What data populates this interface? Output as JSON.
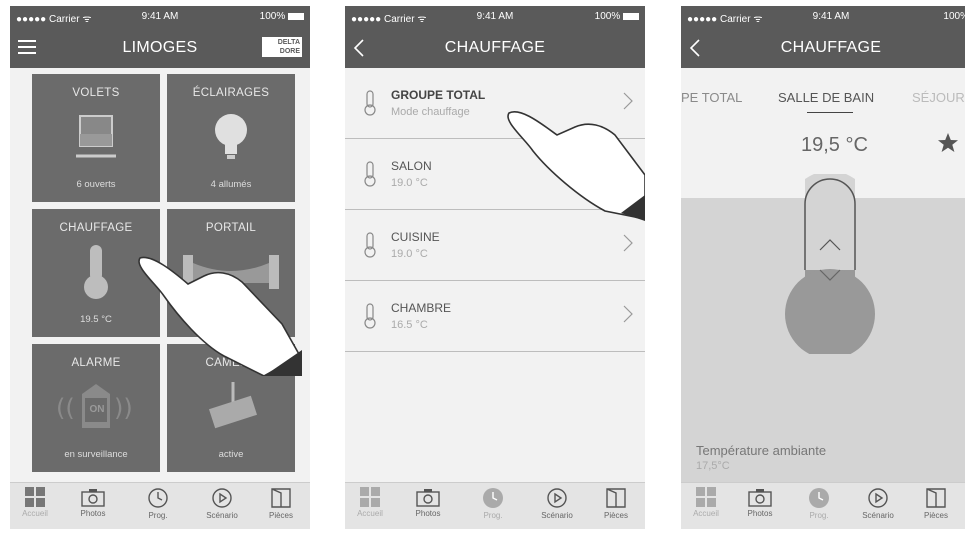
{
  "status": {
    "carrier": "●●●●● Carrier ᯤ",
    "time": "9:41 AM",
    "battery": "100%"
  },
  "home": {
    "title": "LIMOGES",
    "brand": "DELTA DORE",
    "tiles": [
      {
        "title": "VOLETS",
        "sub": "6 ouverts",
        "icon": "shutter-icon"
      },
      {
        "title": "ÉCLAIRAGES",
        "sub": "4 allumés",
        "icon": "bulb-icon"
      },
      {
        "title": "CHAUFFAGE",
        "sub": "19.5 °C",
        "icon": "thermometer-icon"
      },
      {
        "title": "PORTAIL",
        "sub": "",
        "icon": "gate-icon"
      },
      {
        "title": "ALARME",
        "sub": "en surveillance",
        "icon": "alarm-icon",
        "badge": "ON"
      },
      {
        "title": "CAMÉRA",
        "sub": "active",
        "icon": "camera-icon"
      }
    ]
  },
  "heating": {
    "title": "CHAUFFAGE",
    "rows": [
      {
        "name": "GROUPE TOTAL",
        "value": "Mode chauffage"
      },
      {
        "name": "SALON",
        "value": "19.0 °C"
      },
      {
        "name": "CUISINE",
        "value": "19.0 °C"
      },
      {
        "name": "CHAMBRE",
        "value": "16.5 °C"
      }
    ]
  },
  "room": {
    "title": "CHAUFFAGE",
    "tabs": [
      "PE TOTAL",
      "SALLE DE BAIN",
      "SÉJOUR"
    ],
    "setpoint": "19,5 °C",
    "ambient_label": "Température ambiante",
    "ambient_value": "17,5°C"
  },
  "tabbar": {
    "home": "Accueil",
    "photos": "Photos",
    "prog": "Prog.",
    "scenario": "Scénario",
    "rooms": "Pièces"
  },
  "colors": {
    "bar": "#5a5a5a",
    "tile": "#6b6b6b",
    "background": "#f2f2f2"
  }
}
